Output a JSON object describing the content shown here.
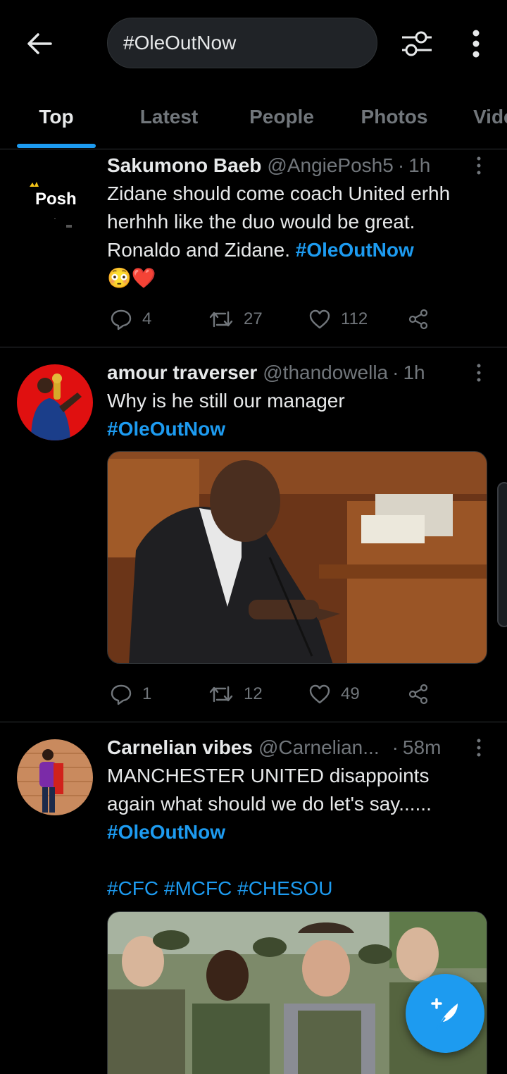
{
  "search": {
    "query": "#OleOutNow"
  },
  "tabs": [
    {
      "label": "Top",
      "active": true
    },
    {
      "label": "Latest"
    },
    {
      "label": "People"
    },
    {
      "label": "Photos"
    },
    {
      "label": "Vide"
    }
  ],
  "tweets": [
    {
      "name": "Sakumono Baeb",
      "handle": "@AngiePosh5",
      "time": "1h",
      "avatar_text": "Posh",
      "lines": [
        "Zidane should come coach United erhh",
        "herhhh like the duo would be great.",
        "Ronaldo and Zidane. "
      ],
      "hashtag": "#OleOutNow",
      "emoji": "😳❤️",
      "replies": "4",
      "retweets": "27",
      "likes": "112"
    },
    {
      "name": "amour traverser",
      "handle": "@thandowella",
      "time": "1h",
      "lines": [
        "Why is he still our manager"
      ],
      "hashtag": "#OleOutNow",
      "replies": "1",
      "retweets": "12",
      "likes": "49"
    },
    {
      "name": "Carnelian vibes",
      "handle": "@Carnelian...",
      "time": "58m",
      "lines": [
        "MANCHESTER UNITED disappoints",
        "again what should we do let's say......"
      ],
      "hashtag": "#OleOutNow",
      "extra_tags": "#CFC #MCFC #CHESOU"
    }
  ],
  "colors": {
    "accent": "#1d9bf0",
    "background": "#000000",
    "muted": "#71767b"
  }
}
